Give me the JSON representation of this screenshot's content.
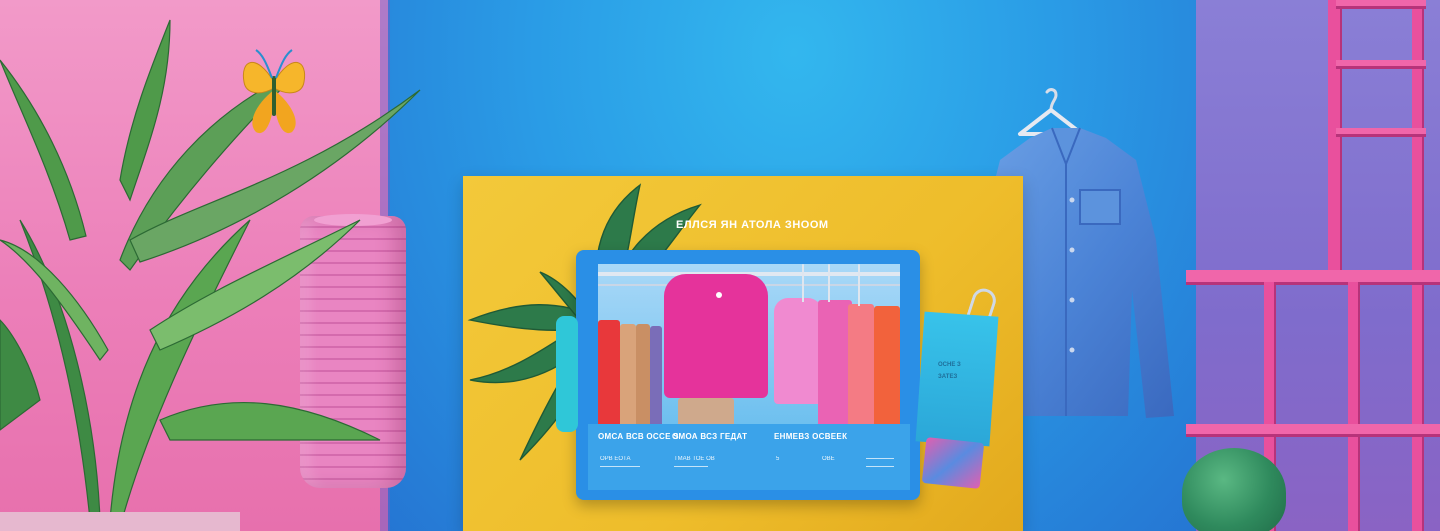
{
  "scene": {
    "colors": {
      "pink_wall": "#ec7fb9",
      "blue_wall": "#2a9ce6",
      "purple_wall": "#7f6ccc",
      "yellow_board": "#eebd2b",
      "screen_blue": "#2a8fe6",
      "shelf_pink": "#e9509d",
      "shirt_denim": "#4b83d6"
    }
  },
  "board": {
    "title": "ЕЛЛСЯ ЯН АТОЛА ЗНООМ"
  },
  "screen": {
    "footer": {
      "col1_heading": "ОМСА ВСВ ОССЕ Ѕ",
      "col1_small": "ОРВ ЕОТА",
      "col2_heading": "ОМОА ВСЗ ГЕДАТ",
      "col2_small": "ТМАВ ТОЕ  ОВ",
      "col3_heading": "ЕНМЕВЗ ОСВЕЕК",
      "col3_small_a": "5",
      "col3_small_b": "ОВЕ"
    }
  },
  "bag": {
    "line1": "ОСНЕ З",
    "line2": "ЗАТЕЗ"
  }
}
